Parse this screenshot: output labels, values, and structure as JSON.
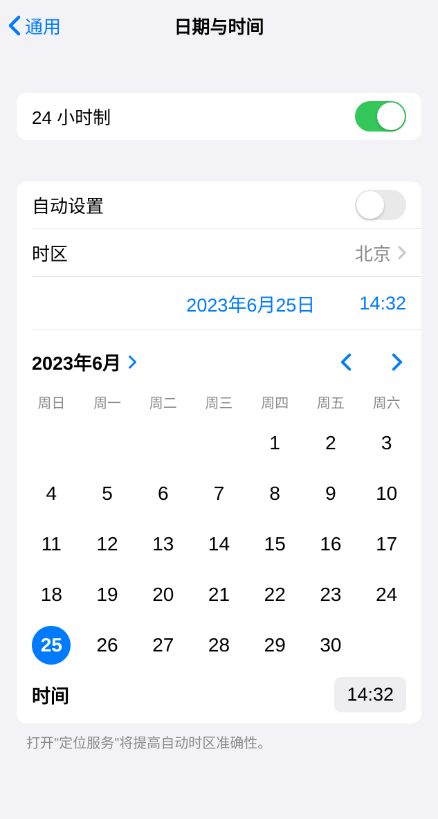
{
  "nav": {
    "back_label": "通用",
    "title": "日期与时间"
  },
  "settings": {
    "twenty_four_hour_label": "24 小时制",
    "twenty_four_hour_on": true,
    "auto_set_label": "自动设置",
    "auto_set_on": false,
    "timezone_label": "时区",
    "timezone_value": "北京"
  },
  "datetime": {
    "date_display": "2023年6月25日",
    "time_display": "14:32"
  },
  "calendar": {
    "month_label": "2023年6月",
    "weekdays": [
      "周日",
      "周一",
      "周二",
      "周三",
      "周四",
      "周五",
      "周六"
    ],
    "leading_blanks": 4,
    "days_in_month": 30,
    "selected_day": 25
  },
  "time_picker": {
    "label": "时间",
    "value": "14:32"
  },
  "footer": "打开\"定位服务\"将提高自动时区准确性。"
}
